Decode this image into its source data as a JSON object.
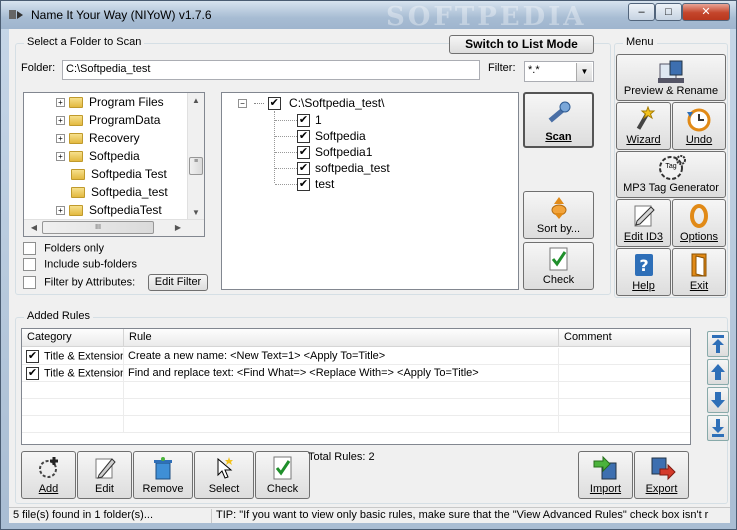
{
  "window": {
    "title": "Name It Your Way (NIYoW) v1.7.6",
    "watermark": "SOFTPEDIA",
    "min_glyph": "–",
    "max_glyph": "□",
    "close_glyph": "✕"
  },
  "scan_group": {
    "legend": "Select a Folder to Scan",
    "switch_label": "Switch to List Mode",
    "folder_label": "Folder:",
    "folder_value": "C:\\Softpedia_test",
    "filter_label": "Filter:",
    "filter_value": "*.*"
  },
  "folder_tree": [
    {
      "name": "Program Files",
      "expandable": true
    },
    {
      "name": "ProgramData",
      "expandable": true
    },
    {
      "name": "Recovery",
      "expandable": true
    },
    {
      "name": "Softpedia",
      "expandable": true
    },
    {
      "name": "Softpedia Test",
      "expandable": false
    },
    {
      "name": "Softpedia_test",
      "expandable": false
    },
    {
      "name": "SoftpediaTest",
      "expandable": true
    }
  ],
  "file_tree": {
    "root": "C:\\Softpedia_test\\",
    "children": [
      "1",
      "Softpedia",
      "Softpedia1",
      "softpedia_test",
      "test"
    ]
  },
  "options": {
    "folders_only": "Folders only",
    "include_subfolders": "Include sub-folders",
    "filter_by_attributes": "Filter by Attributes:",
    "edit_filter": "Edit Filter"
  },
  "scan_buttons": {
    "scan": "Scan",
    "sort_by": "Sort by...",
    "check": "Check"
  },
  "menu": {
    "legend": "Menu",
    "preview_rename": "Preview & Rename",
    "wizard": "Wizard",
    "undo": "Undo",
    "mp3_tag": "MP3 Tag Generator",
    "tag_icon_text": "Tag",
    "edit_id3": "Edit ID3",
    "options": "Options",
    "help": "Help",
    "exit": "Exit"
  },
  "rules": {
    "legend": "Added Rules",
    "columns": [
      "Category",
      "Rule",
      "Comment"
    ],
    "rows": [
      {
        "category": "Title & Extension",
        "rule": "Create a new name: <New Text=1> <Apply To=Title>",
        "comment": ""
      },
      {
        "category": "Title & Extension",
        "rule": "Find and replace text: <Find What=> <Replace With=> <Apply To=Title>",
        "comment": ""
      }
    ],
    "total": "Total Rules: 2"
  },
  "bottom_buttons": {
    "add": "Add",
    "edit": "Edit",
    "remove": "Remove",
    "select": "Select",
    "check": "Check",
    "import": "Import",
    "export": "Export"
  },
  "status": {
    "files_found": "5 file(s) found in 1 folder(s)...",
    "tip": "TIP: \"If you want to view only basic rules, make sure that the \"View Advanced Rules\" check box isn't r"
  },
  "glyphs": {
    "check": "✔",
    "plus": "+",
    "minus": "−",
    "up": "▲",
    "down": "▼",
    "left": "◀",
    "right": "▶"
  },
  "colors": {
    "accent_blue": "#2e6fb8",
    "close_red": "#c4452b",
    "orange": "#e18a17"
  }
}
